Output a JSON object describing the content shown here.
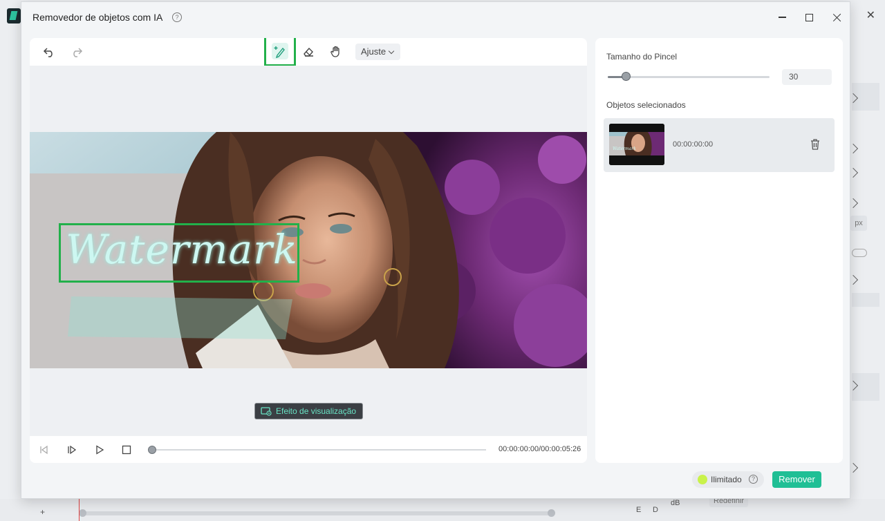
{
  "dialog": {
    "title": "Removedor de objetos com IA",
    "help_glyph": "?",
    "controls": [
      "minimize-icon",
      "maximize-icon",
      "close-icon"
    ]
  },
  "toolbar": {
    "icons": [
      "undo-icon",
      "redo-icon",
      "smart-brush-icon",
      "eraser-icon",
      "hand-pan-icon"
    ],
    "active_tool": "smart-brush-icon",
    "ajuste_label": "Ajuste"
  },
  "canvas": {
    "watermark_text": "Watermark",
    "preview_label": "Efeito de visualização"
  },
  "playback": {
    "icons": [
      "previous-frame-icon",
      "next-frame-icon",
      "play-icon",
      "stop-icon"
    ],
    "progress": 0,
    "timecode": "00:00:00:00/00:00:05:26"
  },
  "side": {
    "brush_size_label": "Tamanho do Pincel",
    "brush_size_value": "30",
    "selected_label": "Objetos selecionados",
    "objects": [
      {
        "time": "00:00:00:00",
        "thumb_text": "Watermark"
      }
    ]
  },
  "footer": {
    "unlimited_label": "Ilimitado",
    "help_glyph": "?",
    "remove_label": "Remover"
  },
  "background": {
    "redefinir_label": "Redefinir",
    "db_label": "dB",
    "e_label": "E",
    "d_label": "D",
    "px_label": "px",
    "plus_label": "+"
  },
  "colors": {
    "accent": "#1fbf95",
    "highlight_box": "#22b04a",
    "watermark_fill": "#cdf7f1"
  }
}
